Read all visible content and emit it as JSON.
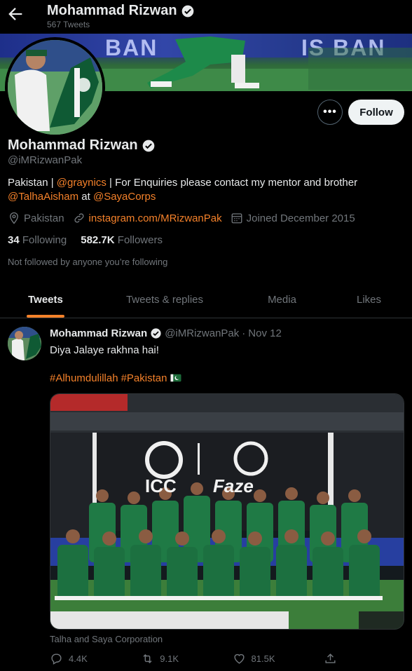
{
  "header": {
    "name": "Mohammad Rizwan",
    "tweet_count": "567 Tweets"
  },
  "banner": {
    "text_left": "BAN",
    "text_right": "IS BAN"
  },
  "profile": {
    "name": "Mohammad Rizwan",
    "handle": "@iMRizwanPak",
    "bio_parts": [
      "Pakistan | ",
      "@graynics",
      " | For Enquiries please contact my mentor and brother ",
      "@TalhaAisham",
      " at ",
      "@SayaCorps"
    ],
    "location": "Pakistan",
    "website": "instagram.com/MRizwanPak",
    "joined": "Joined December 2015",
    "following_count": "34",
    "following_label": "Following",
    "followers_count": "582.7K",
    "followers_label": "Followers",
    "not_followed": "Not followed by anyone you’re following",
    "follow_button": "Follow",
    "more_button": "•••"
  },
  "tabs": [
    "Tweets",
    "Tweets & replies",
    "Media",
    "Likes"
  ],
  "tweet": {
    "author": "Mohammad Rizwan",
    "handle": "@iMRizwanPak",
    "sep": "·",
    "date": "Nov 12",
    "text": "Diya Jalaye rakhna hai!",
    "hashtag1": "#Alhumdulillah",
    "hashtag2": "#Pakistan",
    "flag_emoji": "🇵🇰",
    "media_board_left": "ICC",
    "media_board_right": "Faze",
    "caption": "Talha and Saya Corporation",
    "replies": "4.4K",
    "retweets": "9.1K",
    "likes": "81.5K"
  },
  "colors": {
    "accent": "#f4812a",
    "muted": "#71767b",
    "verified": "#e7e9ea",
    "jersey": "#1f7a45"
  }
}
